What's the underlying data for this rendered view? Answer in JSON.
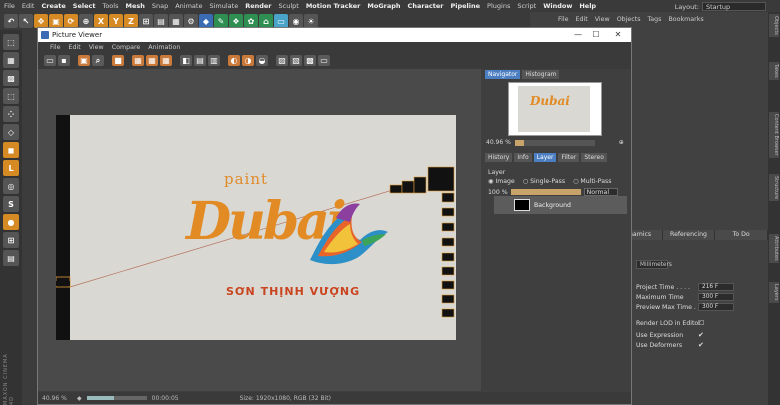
{
  "menubar": {
    "items": [
      "File",
      "Edit",
      "Create",
      "Select",
      "Tools",
      "Mesh",
      "Snap",
      "Animate",
      "Simulate",
      "Render",
      "Sculpt",
      "Motion Tracker",
      "MoGraph",
      "Character",
      "Pipeline",
      "Plugins",
      "Script",
      "Window",
      "Help"
    ],
    "highlight": [
      "Create",
      "Select",
      "Mesh",
      "Render",
      "Motion Tracker",
      "MoGraph",
      "Character",
      "Pipeline",
      "Window",
      "Help"
    ],
    "layout_label": "Layout:",
    "layout_value": "Startup"
  },
  "toolbar": {
    "axis_x": "X",
    "axis_y": "Y",
    "axis_z": "Z"
  },
  "object_manager": {
    "menu": [
      "File",
      "Edit",
      "View",
      "Objects",
      "Tags",
      "Bookmarks"
    ]
  },
  "attributes": {
    "tabs": [
      "Dynamics",
      "Referencing",
      "To Do"
    ],
    "unit_value": "Millimeters",
    "rows": [
      {
        "label": "Project Time . . . .",
        "value": "216 F"
      },
      {
        "label": "Maximum Time",
        "value": "300 F"
      },
      {
        "label": "Preview Max Time . . .",
        "value": "300 F"
      }
    ],
    "checks": [
      {
        "label": "Render LOD in Editor",
        "checked": "☐"
      },
      {
        "label": "Use Expression",
        "checked": "✔"
      },
      {
        "label": "Use Deformers",
        "checked": "✔"
      }
    ]
  },
  "right_strip": [
    "Objects",
    "Takes",
    "Content Browser",
    "Structure",
    "Attributes",
    "Layers"
  ],
  "picture_viewer": {
    "title": "Picture Viewer",
    "menu": [
      "File",
      "Edit",
      "View",
      "Compare",
      "Animation"
    ],
    "status": {
      "zoom": "40.96 %",
      "timecode": "00:00:05",
      "info": "Size: 1920x1080, RGB (32 Bit)",
      "progress": 0.45
    },
    "navigator_tabs": [
      {
        "label": "Navigator",
        "active": true
      },
      {
        "label": "Histogram",
        "active": false
      }
    ],
    "nav_zoom": {
      "value": "40.96 %",
      "fraction": 0.12
    },
    "layer_tabs": [
      {
        "label": "History",
        "active": false
      },
      {
        "label": "Info",
        "active": false
      },
      {
        "label": "Layer",
        "active": true
      },
      {
        "label": "Filter",
        "active": false
      },
      {
        "label": "Stereo",
        "active": false
      }
    ],
    "layer_header": "Layer",
    "radios": [
      "Image",
      "Single-Pass",
      "Multi-Pass"
    ],
    "opacity": {
      "value": "100 %",
      "fraction": 1.0,
      "mode": "Normal"
    },
    "layer_item": "Background"
  },
  "render_logo": {
    "top": "paint",
    "main": "Dubai",
    "sub": "SƠN THỊNH VƯỢNG"
  },
  "colors": {
    "accent_blue": "#4c7fc1",
    "logo_orange": "#e28a23",
    "logo_red": "#c9441f"
  }
}
